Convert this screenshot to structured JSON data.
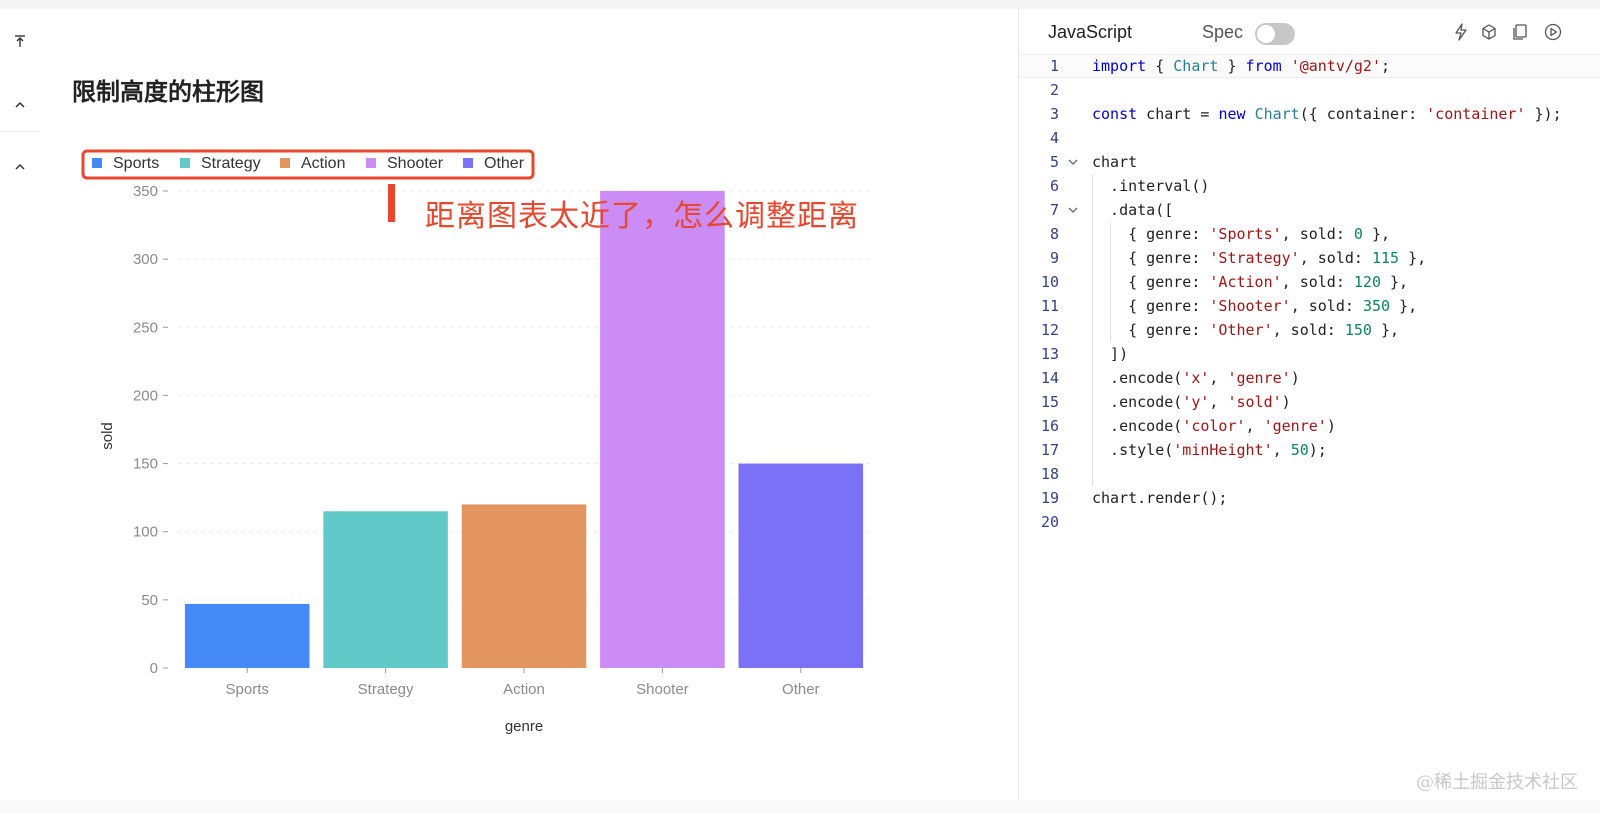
{
  "page": {
    "title": "限制高度的柱形图",
    "annotation": "距离图表太近了，怎么调整距离",
    "watermark": "@稀土掘金技术社区"
  },
  "rail": {
    "icons": [
      "vertical-align-top-icon",
      "chevron-up-icon",
      "chevron-up-icon"
    ]
  },
  "editor": {
    "tab_js": "JavaScript",
    "tab_spec": "Spec",
    "spec_toggle_on": false,
    "tools": [
      "thunderbolt-icon",
      "codesandbox-icon",
      "copy-icon",
      "play-icon"
    ],
    "active_line": 1,
    "fold_lines": [
      5,
      7
    ],
    "lines": [
      {
        "n": "1",
        "indent": 0,
        "html": "<span class=\"kw\">import</span> { <span class=\"cls\">Chart</span> } <span class=\"kw\">from</span> <span class=\"str\">'@antv/g2'</span>;"
      },
      {
        "n": "2",
        "indent": 0,
        "html": ""
      },
      {
        "n": "3",
        "indent": 0,
        "html": "<span class=\"kw\">const</span> chart = <span class=\"kw\">new</span> <span class=\"cls\">Chart</span>({ container: <span class=\"str\">'container'</span> });"
      },
      {
        "n": "4",
        "indent": 0,
        "html": ""
      },
      {
        "n": "5",
        "indent": 0,
        "html": "chart"
      },
      {
        "n": "6",
        "indent": 1,
        "html": "  .interval()"
      },
      {
        "n": "7",
        "indent": 1,
        "html": "  .data(["
      },
      {
        "n": "8",
        "indent": 2,
        "html": "    { genre: <span class=\"str\">'Sports'</span>, sold: <span class=\"num\">0</span> },"
      },
      {
        "n": "9",
        "indent": 2,
        "html": "    { genre: <span class=\"str\">'Strategy'</span>, sold: <span class=\"num\">115</span> },"
      },
      {
        "n": "10",
        "indent": 2,
        "html": "    { genre: <span class=\"str\">'Action'</span>, sold: <span class=\"num\">120</span> },"
      },
      {
        "n": "11",
        "indent": 2,
        "html": "    { genre: <span class=\"str\">'Shooter'</span>, sold: <span class=\"num\">350</span> },"
      },
      {
        "n": "12",
        "indent": 2,
        "html": "    { genre: <span class=\"str\">'Other'</span>, sold: <span class=\"num\">150</span> },"
      },
      {
        "n": "13",
        "indent": 1,
        "html": "  ])"
      },
      {
        "n": "14",
        "indent": 1,
        "html": "  .encode(<span class=\"str\">'x'</span>, <span class=\"str\">'genre'</span>)"
      },
      {
        "n": "15",
        "indent": 1,
        "html": "  .encode(<span class=\"str\">'y'</span>, <span class=\"str\">'sold'</span>)"
      },
      {
        "n": "16",
        "indent": 1,
        "html": "  .encode(<span class=\"str\">'color'</span>, <span class=\"str\">'genre'</span>)"
      },
      {
        "n": "17",
        "indent": 1,
        "html": "  .style(<span class=\"str\">'minHeight'</span>, <span class=\"num\">50</span>);"
      },
      {
        "n": "18",
        "indent": 1,
        "html": ""
      },
      {
        "n": "19",
        "indent": 0,
        "html": "chart.render();"
      },
      {
        "n": "20",
        "indent": 0,
        "html": ""
      }
    ]
  },
  "chart_data": {
    "type": "bar",
    "categories": [
      "Sports",
      "Strategy",
      "Action",
      "Shooter",
      "Other"
    ],
    "values": [
      47,
      115,
      120,
      350,
      150
    ],
    "colors": [
      "#4589f7",
      "#62c9c9",
      "#e3955f",
      "#cb8cf5",
      "#7b71f7"
    ],
    "legend": [
      "Sports",
      "Strategy",
      "Action",
      "Shooter",
      "Other"
    ],
    "legend_placement": "top-left",
    "title": "",
    "xlabel": "genre",
    "ylabel": "sold",
    "ylim": [
      0,
      350
    ],
    "yticks": [
      0,
      50,
      100,
      150,
      200,
      250,
      300,
      350
    ],
    "grid": true,
    "highlight_color": "#e8472e"
  }
}
